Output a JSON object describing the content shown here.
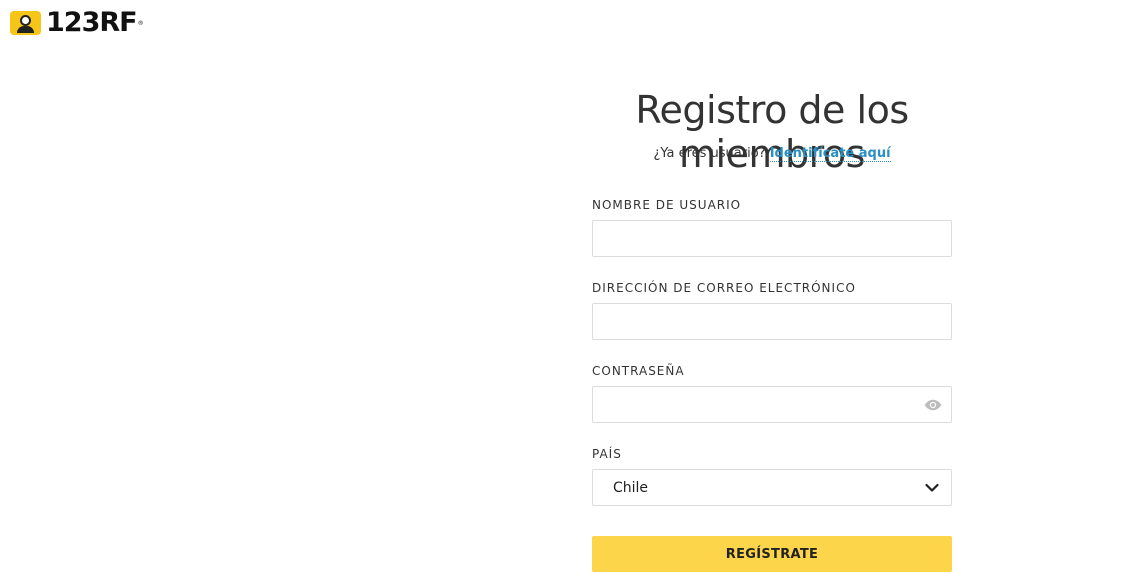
{
  "brand": {
    "logo_text": "123RF",
    "accent_color": "#f5c518"
  },
  "page": {
    "title": "Registro de los miembros",
    "subtitle_text": "¿Ya eres usuario?",
    "login_link": "Identifícate aquí"
  },
  "form": {
    "username": {
      "label": "NOMBRE DE USUARIO",
      "value": "",
      "placeholder": ""
    },
    "email": {
      "label": "DIRECCIÓN DE CORREO ELECTRÓNICO",
      "value": "",
      "placeholder": ""
    },
    "password": {
      "label": "CONTRASEÑA",
      "value": "",
      "placeholder": "",
      "toggle_icon": "eye-icon"
    },
    "country": {
      "label": "PAÍS",
      "selected": "Chile",
      "icon": "chevron-down-icon"
    },
    "submit_label": "REGÍSTRATE",
    "submit_color": "#fdd54a",
    "link_color": "#2a8fc4"
  }
}
